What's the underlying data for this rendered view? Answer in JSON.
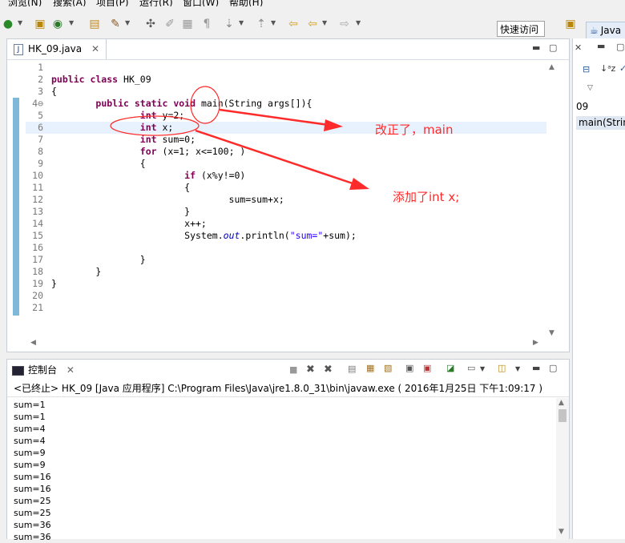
{
  "menu": {
    "items": [
      "浏览(N)",
      "搜索(A)",
      "项目(P)",
      "运行(R)",
      "窗口(W)",
      "帮助(H)"
    ]
  },
  "toolbar": {
    "quick_access_placeholder": "快速访问",
    "perspective_label": "Java"
  },
  "editor": {
    "tab_label": "HK_09.java",
    "tab_icon": "J",
    "lines": [
      {
        "n": "1",
        "html": ""
      },
      {
        "n": "2",
        "html": "<span class=\"kw\">public class</span> HK_09"
      },
      {
        "n": "3",
        "html": "{"
      },
      {
        "n": "4⊖",
        "html": "        <span class=\"kw\">public static void</span> main(String args[]){"
      },
      {
        "n": "5",
        "html": "                <span class=\"kw\">int</span> y=2;"
      },
      {
        "n": "6",
        "html": "                <span class=\"kw\">int</span> x;"
      },
      {
        "n": "7",
        "html": "                <span class=\"kw\">int</span> sum=0;"
      },
      {
        "n": "8",
        "html": "                <span class=\"kw\">for</span> (x=1; x<=100; )"
      },
      {
        "n": "9",
        "html": "                {"
      },
      {
        "n": "10",
        "html": "                        <span class=\"kw\">if</span> (x%y!=0)"
      },
      {
        "n": "11",
        "html": "                        {"
      },
      {
        "n": "12",
        "html": "                                sum=sum+x;"
      },
      {
        "n": "13",
        "html": "                        }"
      },
      {
        "n": "14",
        "html": "                        x++;"
      },
      {
        "n": "15",
        "html": "                        System.<span class=\"fld\">out</span>.println(<span class=\"str\">\"sum=\"</span>+sum);"
      },
      {
        "n": "16",
        "html": ""
      },
      {
        "n": "17",
        "html": "                }"
      },
      {
        "n": "18",
        "html": "        }"
      },
      {
        "n": "19",
        "html": "}"
      },
      {
        "n": "20",
        "html": ""
      },
      {
        "n": "21",
        "html": ""
      }
    ],
    "highlighted_line": 6
  },
  "annotations": {
    "note1": "改正了，main",
    "note2": "添加了int x;"
  },
  "console": {
    "tab_label": "控制台",
    "status": "<已终止> HK_09 [Java 应用程序] C:\\Program Files\\Java\\jre1.8.0_31\\bin\\javaw.exe ( 2016年1月25日 下午1:09:17 )",
    "output": [
      "sum=1",
      "sum=1",
      "sum=4",
      "sum=4",
      "sum=9",
      "sum=9",
      "sum=16",
      "sum=16",
      "sum=25",
      "sum=25",
      "sum=36",
      "sum=36"
    ]
  },
  "outline": {
    "item1": "09",
    "item2": "main(String"
  },
  "colors": {
    "keyword": "#7f0055",
    "string": "#2a00ff",
    "annotation": "#ff2a2a",
    "line_highlight": "#e8f2fe"
  }
}
